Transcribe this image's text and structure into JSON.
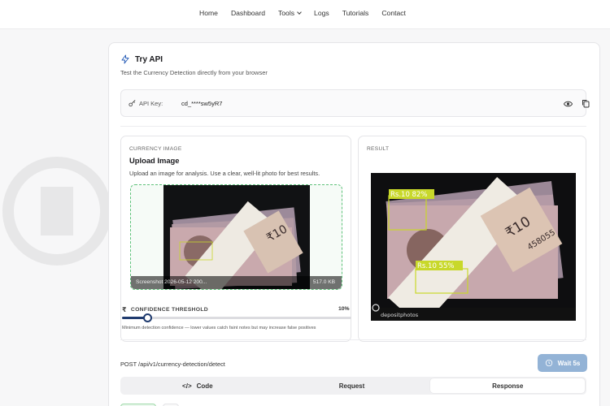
{
  "nav": {
    "items": [
      {
        "label": "Home"
      },
      {
        "label": "Dashboard"
      },
      {
        "label": "Tools"
      },
      {
        "label": "Logs"
      },
      {
        "label": "Tutorials"
      },
      {
        "label": "Contact"
      }
    ]
  },
  "try_api": {
    "title": "Try API",
    "subtitle": "Test the Currency Detection directly from your browser",
    "icon": "bolt-icon"
  },
  "api_key": {
    "label": "API Key:",
    "value": "cd_****sw5yR7"
  },
  "upload": {
    "section_label": "CURRENCY IMAGE",
    "title": "Upload Image",
    "description": "Upload an image for analysis. Use a clear, well-lit photo for best results.",
    "file_name": "Screenshot 2026-05-12 200...",
    "file_size": "517.0 KB"
  },
  "confidence": {
    "label": "CONFIDENCE THRESHOLD",
    "value_text": "10%",
    "value": 0.1,
    "help": "Minimum detection confidence — lower values catch faint notes but may increase false positives"
  },
  "result": {
    "section_label": "RESULT",
    "detections": [
      {
        "label": "Rs.10 82%"
      },
      {
        "label": "Rs.10 55%"
      }
    ],
    "watermark": "depositphotos"
  },
  "request": {
    "endpoint": "POST /api/v1/currency-detection/detect",
    "wait_label": "Wait 5s"
  },
  "tabs": [
    {
      "label": "Code"
    },
    {
      "label": "Request"
    },
    {
      "label": "Response"
    }
  ],
  "colors": {
    "accent": "#1f3a6e",
    "dropzone_border": "#5ec27a",
    "detection_box": "#c8d82a",
    "wait_button": "#93b3d6"
  }
}
